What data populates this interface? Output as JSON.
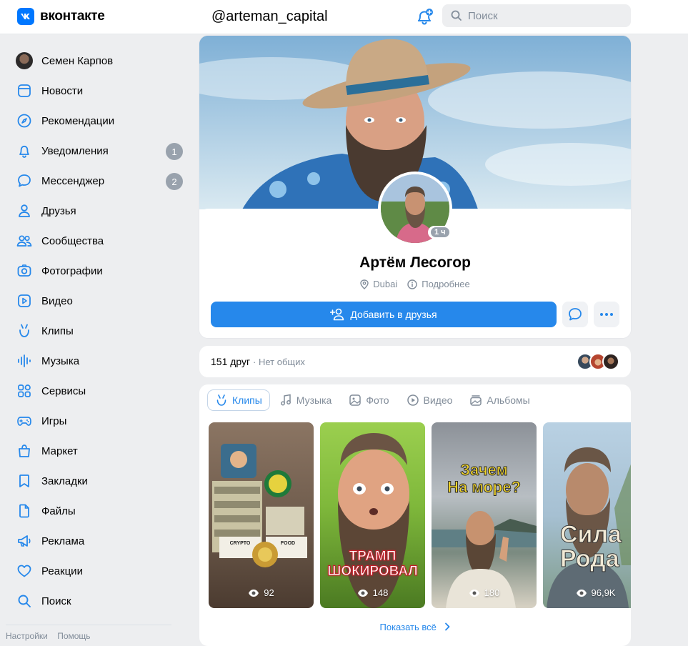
{
  "header": {
    "logo_mark": "vk",
    "logo_text": "вконтакте",
    "handle": "@arteman_capital",
    "search_placeholder": "Поиск"
  },
  "sidebar": {
    "profile_name": "Семен Карпов",
    "items": [
      {
        "label": "Новости",
        "icon": "news-icon"
      },
      {
        "label": "Рекомендации",
        "icon": "compass-icon"
      },
      {
        "label": "Уведомления",
        "icon": "bell-icon",
        "badge": "1"
      },
      {
        "label": "Мессенджер",
        "icon": "chat-icon",
        "badge": "2"
      },
      {
        "label": "Друзья",
        "icon": "user-icon"
      },
      {
        "label": "Сообщества",
        "icon": "users-icon"
      },
      {
        "label": "Фотографии",
        "icon": "camera-icon"
      },
      {
        "label": "Видео",
        "icon": "video-icon"
      },
      {
        "label": "Клипы",
        "icon": "clips-icon"
      },
      {
        "label": "Музыка",
        "icon": "music-icon"
      },
      {
        "label": "Сервисы",
        "icon": "services-icon"
      },
      {
        "label": "Игры",
        "icon": "gamepad-icon"
      },
      {
        "label": "Маркет",
        "icon": "bag-icon"
      },
      {
        "label": "Закладки",
        "icon": "bookmark-icon"
      },
      {
        "label": "Файлы",
        "icon": "file-icon"
      },
      {
        "label": "Реклама",
        "icon": "megaphone-icon"
      },
      {
        "label": "Реакции",
        "icon": "heart-icon"
      },
      {
        "label": "Поиск",
        "icon": "search-icon"
      }
    ],
    "footer": {
      "settings": "Настройки",
      "help": "Помощь"
    }
  },
  "profile": {
    "name": "Артём Лесогор",
    "location": "Dubai",
    "details": "Подробнее",
    "online_time": "1 ч",
    "add_friend": "Добавить в друзья"
  },
  "friends": {
    "count": "151 друг",
    "mutual": "Нет общих"
  },
  "media": {
    "tabs": [
      {
        "label": "Клипы",
        "icon": "clips-icon",
        "active": true
      },
      {
        "label": "Музыка",
        "icon": "music-icon"
      },
      {
        "label": "Фото",
        "icon": "photo-icon"
      },
      {
        "label": "Видео",
        "icon": "video-icon"
      },
      {
        "label": "Альбомы",
        "icon": "albums-icon"
      }
    ],
    "clips": [
      {
        "views": "92",
        "caption": ""
      },
      {
        "views": "148",
        "caption_line1": "ТРАМП",
        "caption_line2": "ШОКИРОВАЛ"
      },
      {
        "views": "180",
        "caption_line1": "Зачем",
        "caption_line2": "На море?"
      },
      {
        "views": "96,9K",
        "caption_line1": "Сила",
        "caption_line2": "Рода"
      }
    ],
    "clip1_labels": {
      "left": "CRYPTO",
      "right": "FOOD"
    },
    "show_all": "Показать всё"
  },
  "colors": {
    "accent": "#2688eb",
    "brand": "#0077ff",
    "background": "#edeef0",
    "muted": "#818c99",
    "badge": "#99a2ad"
  }
}
